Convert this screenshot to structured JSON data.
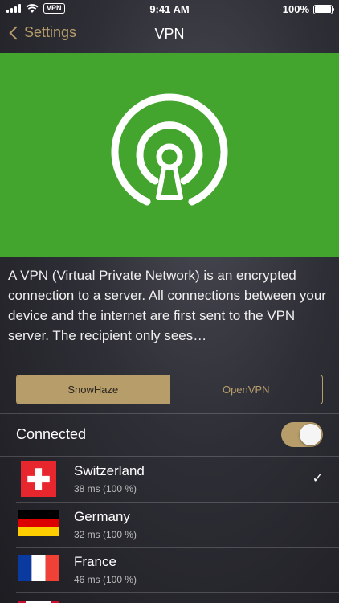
{
  "status_bar": {
    "time": "9:41 AM",
    "vpn_badge": "VPN",
    "battery": "100%"
  },
  "nav": {
    "back_label": "Settings",
    "title": "VPN"
  },
  "description": "A VPN (Virtual Private Network) is an encrypted connection to a server. All connections between your device and the internet are first sent to the VPN server. The recipient only sees…",
  "segments": {
    "active": "SnowHaze",
    "inactive": "OpenVPN"
  },
  "connected": {
    "label": "Connected",
    "enabled": true
  },
  "servers": [
    {
      "name": "Switzerland",
      "detail": "38 ms (100 %)",
      "flag": "switzerland-flag",
      "selected": true
    },
    {
      "name": "Germany",
      "detail": "32 ms (100 %)",
      "flag": "germany-flag",
      "selected": false
    },
    {
      "name": "France",
      "detail": "46 ms (100 %)",
      "flag": "france-flag",
      "selected": false
    }
  ],
  "checkmark": "✓",
  "colors": {
    "accent": "#b79d6a",
    "hero": "#43a42e"
  }
}
